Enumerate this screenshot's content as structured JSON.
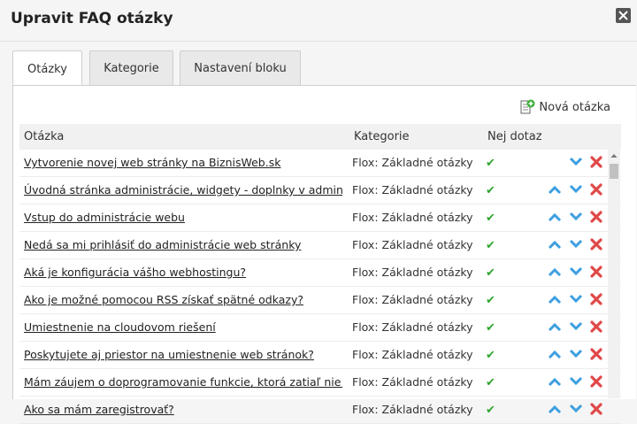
{
  "dialog": {
    "title": "Upravit FAQ otázky",
    "close_icon": "close-icon"
  },
  "tabs": [
    {
      "label": "Otázky",
      "active": true
    },
    {
      "label": "Kategorie",
      "active": false
    },
    {
      "label": "Nastavení bloku",
      "active": false
    }
  ],
  "toolbar": {
    "add_label": "Nová otázka",
    "add_icon": "add-document-icon"
  },
  "table": {
    "columns": [
      "Otázka",
      "Kategorie",
      "Nej dotaz"
    ],
    "rows": [
      {
        "question": "Vytvorenie novej web stránky na BiznisWeb.sk",
        "category": "Flox: Základné otázky",
        "top": true
      },
      {
        "question": "Úvodná stránka administrácie, widgety - doplnky v admine",
        "category": "Flox: Základné otázky",
        "top": true
      },
      {
        "question": "Vstup do administrácie webu",
        "category": "Flox: Základné otázky",
        "top": true
      },
      {
        "question": "Nedá sa mi prihlásiť do administrácie web stránky",
        "category": "Flox: Základné otázky",
        "top": true
      },
      {
        "question": "Aká je konfigurácia vášho webhostingu?",
        "category": "Flox: Základné otázky",
        "top": true
      },
      {
        "question": "Ako je možné pomocou RSS získať spätné odkazy?",
        "category": "Flox: Základné otázky",
        "top": true
      },
      {
        "question": "Umiestnenie na cloudovom riešení",
        "category": "Flox: Základné otázky",
        "top": true
      },
      {
        "question": "Poskytujete aj priestor na umiestnenie web stránok?",
        "category": "Flox: Základné otázky",
        "top": true
      },
      {
        "question": "Mám záujem o doprogramovanie funkcie, ktorá zatiaľ nie je",
        "category": "Flox: Základné otázky",
        "top": true
      },
      {
        "question": "Ako sa mám zaregistrovať?",
        "category": "Flox: Základné otázky",
        "top": true
      }
    ]
  },
  "colors": {
    "check": "#2fa52f",
    "arrow": "#3d9fe0",
    "delete": "#e04848"
  }
}
